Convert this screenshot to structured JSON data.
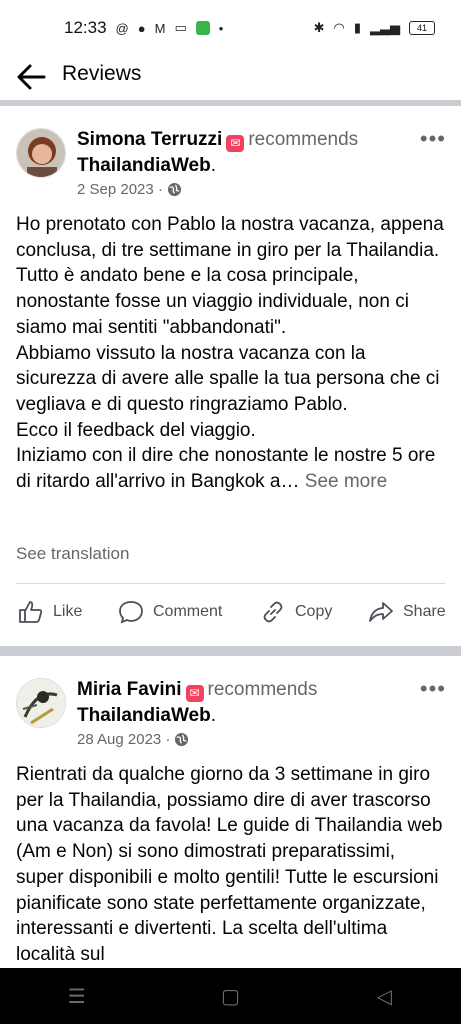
{
  "status": {
    "time": "12:33",
    "battery": "41"
  },
  "header": {
    "title": "Reviews"
  },
  "posts": [
    {
      "author": "Simona Terruzzi",
      "verb": "recommends",
      "page": "ThailandiaWeb",
      "date": "2 Sep 2023 ·",
      "text": "Ho prenotato con Pablo la nostra vacanza, appena conclusa, di tre settimane in giro per la Thailandia.\nTutto è andato bene e la cosa principale, nonostante fosse un viaggio individuale, non ci siamo mai sentiti \"abbandonati\".\nAbbiamo vissuto la nostra vacanza con la sicurezza di avere alle spalle la tua persona che ci vegliava e di questo ringraziamo Pablo.\nEcco il feedback del viaggio.\nIniziamo con il dire che nonostante le nostre 5 ore di ritardo all'arrivo in Bangkok a…",
      "see_more": "See more",
      "see_translation": "See translation"
    },
    {
      "author": "Miria Favini",
      "verb": "recommends",
      "page": "ThailandiaWeb",
      "date": "28 Aug 2023 ·",
      "text": "Rientrati da qualche giorno da 3 settimane in giro per la Thailandia, possiamo dire di aver trascorso una vacanza da favola! Le guide di Thailandia web (Am e Non) si sono dimostrati preparatissimi, super disponibili e molto gentili! Tutte le escursioni pianificate sono state perfettamente organizzate, interessanti e divertenti. La scelta dell'ultima località sul"
    }
  ],
  "actions": {
    "like": "Like",
    "comment": "Comment",
    "copy": "Copy",
    "share": "Share"
  },
  "colors": {
    "badge": "#f3425f",
    "secondary_text": "#65676b",
    "separator": "#c9ccd1"
  }
}
